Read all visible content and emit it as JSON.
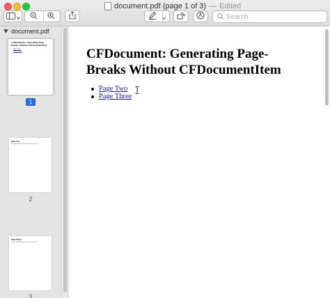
{
  "window": {
    "title": "document.pdf (page 1 of 3)",
    "title_separator": "—",
    "edited_label": "Edited"
  },
  "toolbar": {
    "sidebar_toggle_icon": "sidebar-icon",
    "zoom_out_icon": "zoom-out-icon",
    "zoom_in_icon": "zoom-in-icon",
    "share_icon": "share-icon",
    "markup_icon": "pencil-icon",
    "rotate_icon": "rotate-icon",
    "annotate_icon": "markup-circle-icon"
  },
  "search": {
    "placeholder": "Search",
    "value": ""
  },
  "sidebar": {
    "header": "document.pdf",
    "thumbnails": [
      {
        "page": "1",
        "selected": true,
        "title": "CFDocument: Generating Page-Breaks Without CFDocumentItem",
        "links": [
          "Page Two",
          "Page Three"
        ]
      },
      {
        "page": "2",
        "selected": false,
        "title": "Page Two",
        "text": "Lorem ipsum dolor sit amet page two"
      },
      {
        "page": "3",
        "selected": false,
        "title": "Page Three",
        "text": "Lorem ipsum dolor sit amet page three"
      }
    ]
  },
  "document": {
    "heading": "CFDocument: Generating Page-Breaks Without CFDocumentItem",
    "links": [
      "Page Two",
      "Page Three"
    ]
  },
  "colors": {
    "accent": "#2a6ad9",
    "link": "#1a1aaa"
  }
}
